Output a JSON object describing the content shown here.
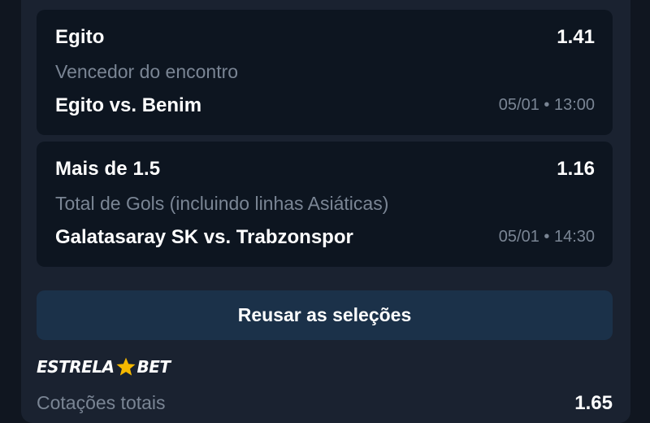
{
  "selections": [
    {
      "selection": "Egito",
      "odd": "1.41",
      "market": "Vencedor do encontro",
      "match": "Egito vs. Benim",
      "datetime": "05/01 • 13:00"
    },
    {
      "selection": "Mais de 1.5",
      "odd": "1.16",
      "market": "Total de Gols (incluindo linhas Asiáticas)",
      "match": "Galatasaray SK vs. Trabzonspor",
      "datetime": "05/01 • 14:30"
    }
  ],
  "reuse_button": {
    "label": "Reusar as seleções"
  },
  "brand": {
    "part1": "ESTRELA",
    "part2": "BET",
    "star_color": "#f5b800"
  },
  "totals": {
    "label": "Cotações totais",
    "value": "1.65"
  },
  "icons": {
    "logo_star": "star-icon"
  }
}
